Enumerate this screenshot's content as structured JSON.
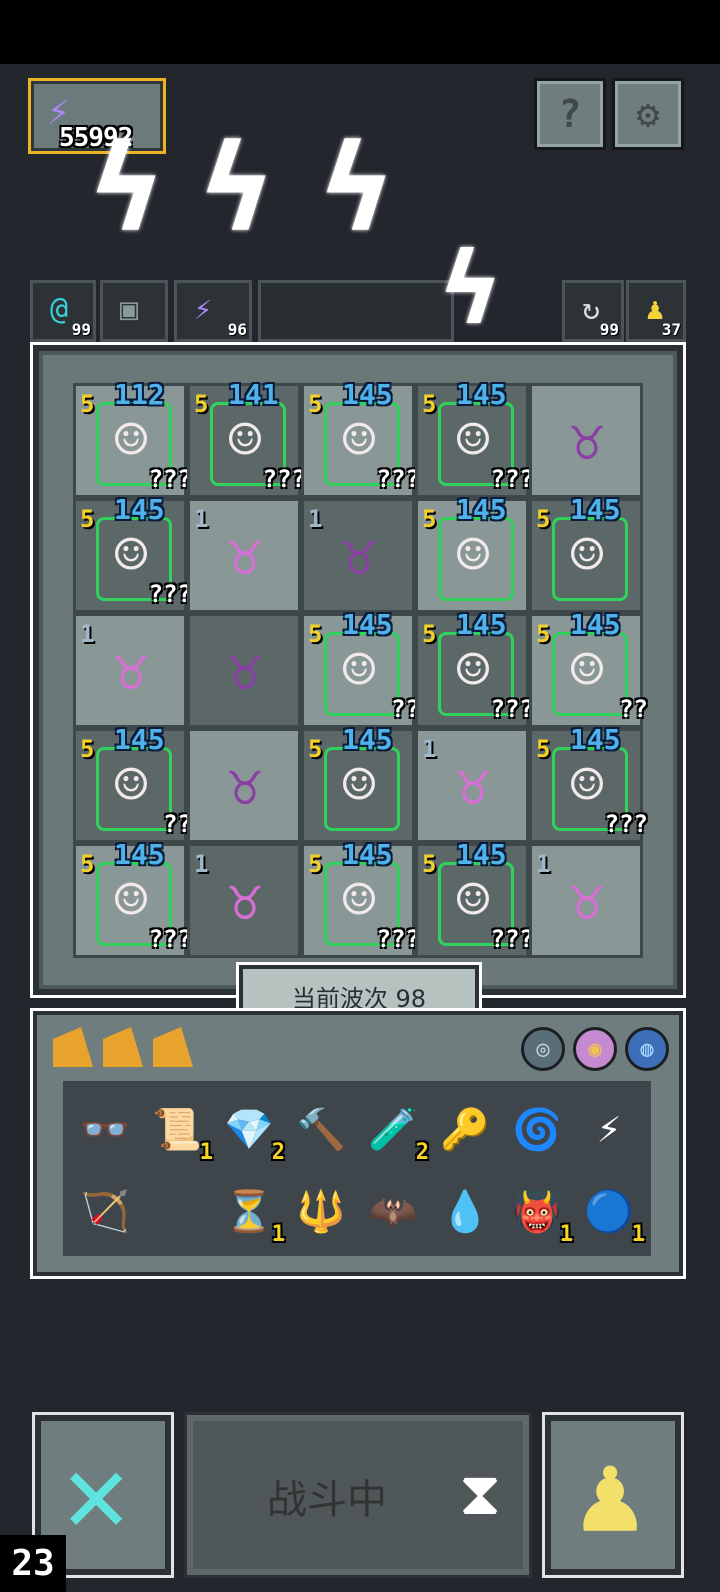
{
  "hud": {
    "energy_value": "55992",
    "help_icon": "?",
    "settings_icon": "gear-icon",
    "res_left_1": "99",
    "res_left_2": "96",
    "res_right_1": "99",
    "res_right_2": "37"
  },
  "board": {
    "wave_label": "当前波次 98",
    "cells": [
      {
        "lvl": "5",
        "lvl_color": "y",
        "unit": "hero",
        "dmg": "112",
        "q": "???"
      },
      {
        "lvl": "5",
        "lvl_color": "y",
        "unit": "hero",
        "dmg": "141",
        "q": "???"
      },
      {
        "lvl": "5",
        "lvl_color": "y",
        "unit": "hero",
        "dmg": "145",
        "q": "???"
      },
      {
        "lvl": "5",
        "lvl_color": "y",
        "unit": "hero",
        "dmg": "145",
        "q": "???"
      },
      {
        "lvl": "",
        "lvl_color": "y",
        "unit": "demon2",
        "dmg": "",
        "q": ""
      },
      {
        "lvl": "5",
        "lvl_color": "y",
        "unit": "hero",
        "dmg": "145",
        "q": "???"
      },
      {
        "lvl": "1",
        "lvl_color": "b",
        "unit": "demon",
        "dmg": "",
        "q": ""
      },
      {
        "lvl": "1",
        "lvl_color": "b",
        "unit": "demon2",
        "dmg": "",
        "q": ""
      },
      {
        "lvl": "5",
        "lvl_color": "y",
        "unit": "hero",
        "dmg": "145",
        "q": ""
      },
      {
        "lvl": "5",
        "lvl_color": "y",
        "unit": "hero",
        "dmg": "145",
        "q": ""
      },
      {
        "lvl": "1",
        "lvl_color": "b",
        "unit": "demon",
        "dmg": "",
        "q": ""
      },
      {
        "lvl": "",
        "lvl_color": "b",
        "unit": "demon2",
        "dmg": "",
        "q": ""
      },
      {
        "lvl": "5",
        "lvl_color": "y",
        "unit": "hero",
        "dmg": "145",
        "q": "??"
      },
      {
        "lvl": "5",
        "lvl_color": "y",
        "unit": "hero",
        "dmg": "145",
        "q": "???"
      },
      {
        "lvl": "5",
        "lvl_color": "y",
        "unit": "hero",
        "dmg": "145",
        "q": "??"
      },
      {
        "lvl": "5",
        "lvl_color": "y",
        "unit": "hero",
        "dmg": "145",
        "q": "??"
      },
      {
        "lvl": "",
        "lvl_color": "b",
        "unit": "demon2",
        "dmg": "",
        "q": ""
      },
      {
        "lvl": "5",
        "lvl_color": "y",
        "unit": "hero",
        "dmg": "145",
        "q": ""
      },
      {
        "lvl": "1",
        "lvl_color": "b",
        "unit": "demon",
        "dmg": "",
        "q": ""
      },
      {
        "lvl": "5",
        "lvl_color": "y",
        "unit": "hero",
        "dmg": "145",
        "q": "???"
      },
      {
        "lvl": "5",
        "lvl_color": "y",
        "unit": "hero",
        "dmg": "145",
        "q": "???"
      },
      {
        "lvl": "1",
        "lvl_color": "b",
        "unit": "demon",
        "dmg": "",
        "q": ""
      },
      {
        "lvl": "5",
        "lvl_color": "y",
        "unit": "hero",
        "dmg": "145",
        "q": "???"
      },
      {
        "lvl": "5",
        "lvl_color": "y",
        "unit": "hero",
        "dmg": "145",
        "q": "???"
      },
      {
        "lvl": "1",
        "lvl_color": "b",
        "unit": "demon",
        "dmg": "",
        "q": ""
      }
    ]
  },
  "inventory": {
    "items": [
      {
        "name": "goggles-icon",
        "glyph": "👓",
        "count": ""
      },
      {
        "name": "scroll-icon",
        "glyph": "📜",
        "count": "1"
      },
      {
        "name": "gem-icon",
        "glyph": "💎",
        "count": "2"
      },
      {
        "name": "hammer-icon",
        "glyph": "🔨",
        "count": ""
      },
      {
        "name": "potion-icon",
        "glyph": "🧪",
        "count": "2"
      },
      {
        "name": "key-icon",
        "glyph": "🔑",
        "count": ""
      },
      {
        "name": "wind-icon",
        "glyph": "🌀",
        "count": ""
      },
      {
        "name": "lightning-icon",
        "glyph": "⚡",
        "count": ""
      },
      {
        "name": "arrow-icon",
        "glyph": "🏹",
        "count": ""
      },
      {
        "name": "hourglass-icon",
        "glyph": "⏳",
        "count": "1"
      },
      {
        "name": "wand-icon",
        "glyph": "🔱",
        "count": ""
      },
      {
        "name": "bat-icon",
        "glyph": "🦇",
        "count": ""
      },
      {
        "name": "droplet-icon",
        "glyph": "💧",
        "count": ""
      },
      {
        "name": "demon-mask-icon",
        "glyph": "👹",
        "count": "1"
      },
      {
        "name": "orb-icon",
        "glyph": "🔵",
        "count": "1"
      }
    ]
  },
  "controls": {
    "battle_label": "战斗中",
    "counter": "23"
  }
}
